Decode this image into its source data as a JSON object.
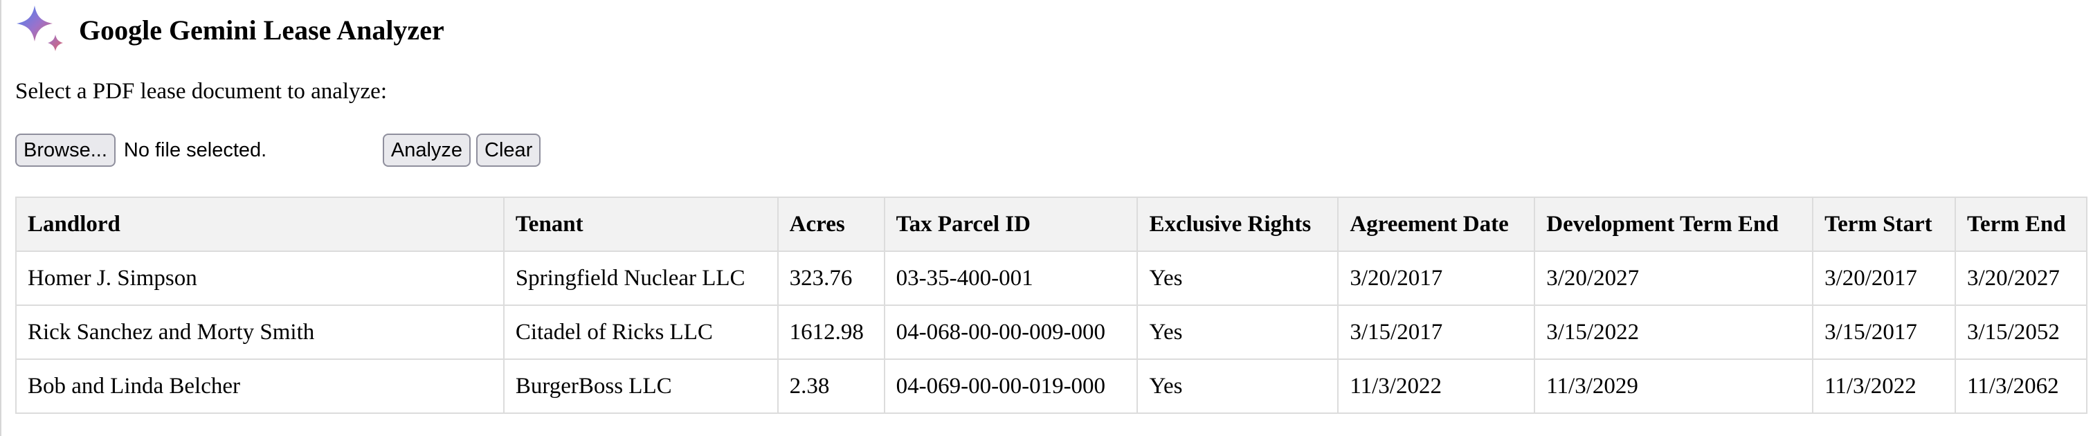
{
  "app": {
    "title": "Google Gemini Lease Analyzer",
    "logo_icon": "gemini-sparkle-icon",
    "accent_colors": [
      "#4285f4",
      "#9b72cb",
      "#d96570"
    ]
  },
  "upload": {
    "prompt": "Select a PDF lease document to analyze:",
    "browse_label": "Browse...",
    "file_status": "No file selected.",
    "analyze_label": "Analyze",
    "clear_label": "Clear"
  },
  "table": {
    "headers": [
      "Landlord",
      "Tenant",
      "Acres",
      "Tax Parcel ID",
      "Exclusive Rights",
      "Agreement Date",
      "Development Term End",
      "Term Start",
      "Term End"
    ],
    "rows": [
      [
        "Homer J. Simpson",
        "Springfield Nuclear LLC",
        "323.76",
        "03-35-400-001",
        "Yes",
        "3/20/2017",
        "3/20/2027",
        "3/20/2017",
        "3/20/2027"
      ],
      [
        "Rick Sanchez and Morty Smith",
        "Citadel of Ricks LLC",
        "1612.98",
        "04-068-00-00-009-000",
        "Yes",
        "3/15/2017",
        "3/15/2022",
        "3/15/2017",
        "3/15/2052"
      ],
      [
        "Bob and Linda Belcher",
        "BurgerBoss LLC",
        "2.38",
        "04-069-00-00-019-000",
        "Yes",
        "11/3/2022",
        "11/3/2029",
        "11/3/2022",
        "11/3/2062"
      ]
    ]
  }
}
